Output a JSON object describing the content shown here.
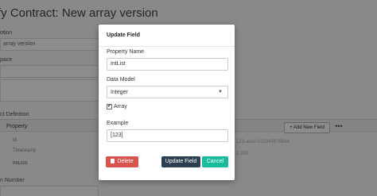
{
  "background": {
    "title": "fy Contract: New array version",
    "labels": {
      "description": "otion",
      "namespace": "pace",
      "object_definition": "ct Definition",
      "version_number": "n Number"
    },
    "description_value": "array version",
    "table": {
      "header_property": "Property",
      "rows": [
        "Id",
        "Timestamp",
        "IntLists"
      ]
    },
    "add_field_label": "+ Add New Field",
    "more_label": "•••",
    "side_texts": [
      "123-abcd-0123456789ab",
      "3.292"
    ]
  },
  "modal": {
    "title": "Update Field",
    "property_name_label": "Property Name",
    "property_name_value": "IntList",
    "data_model_label": "Data Model",
    "data_model_value": "Integer",
    "array_label": "Array",
    "array_checked": true,
    "example_label": "Example",
    "example_value": "[123]",
    "buttons": {
      "delete": "Delete",
      "update": "Update Field",
      "cancel": "Cancel"
    }
  },
  "colors": {
    "delete": "#d9534f",
    "update": "#2c3e50",
    "cancel": "#18bc9c",
    "overlay": "rgba(0,0,0,0.45)"
  }
}
